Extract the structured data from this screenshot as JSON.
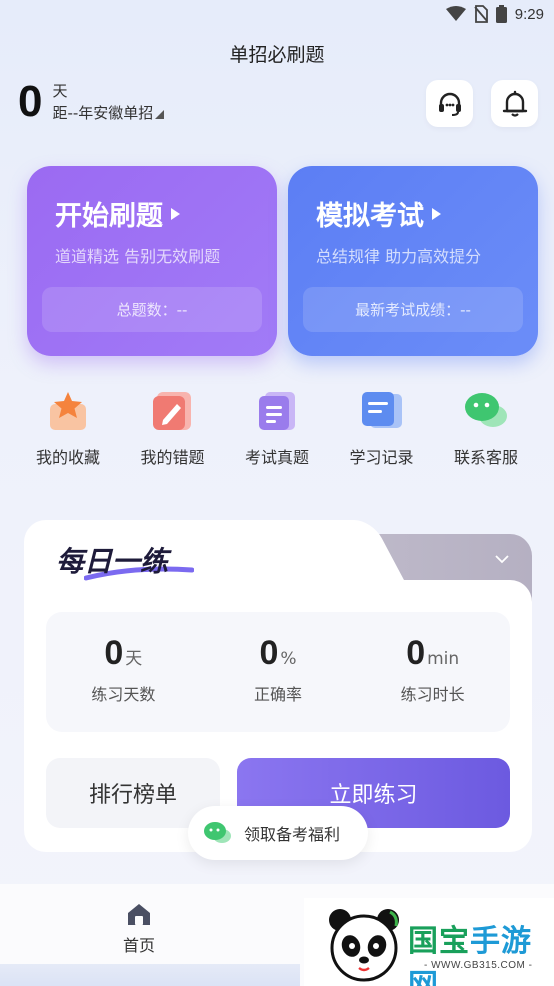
{
  "status_bar": {
    "time": "9:29"
  },
  "header": {
    "title": "单招必刷题",
    "countdown_number": "0",
    "countdown_unit": "天",
    "countdown_desc": "距--年安徽单招"
  },
  "cards": [
    {
      "title": "开始刷题",
      "subtitle": "道道精选 告别无效刷题",
      "footer": "总题数：--",
      "color": "#9b6af2"
    },
    {
      "title": "模拟考试",
      "subtitle": "总结规律 助力高效提分",
      "footer": "最新考试成绩：--",
      "color": "#5c7ef4"
    }
  ],
  "quick_links": [
    {
      "label": "我的收藏",
      "icon": "star-folder-icon"
    },
    {
      "label": "我的错题",
      "icon": "pen-book-icon"
    },
    {
      "label": "考试真题",
      "icon": "exam-paper-icon"
    },
    {
      "label": "学习记录",
      "icon": "study-record-icon"
    },
    {
      "label": "联系客服",
      "icon": "wechat-service-icon"
    }
  ],
  "daily": {
    "title": "每日一练",
    "stats": [
      {
        "value": "0",
        "unit": "天",
        "label": "练习天数"
      },
      {
        "value": "0",
        "unit": "%",
        "label": "正确率"
      },
      {
        "value": "0",
        "unit": "min",
        "label": "练习时长"
      }
    ],
    "rank_label": "排行榜单",
    "practice_label": "立即练习"
  },
  "welfare": {
    "label": "领取备考福利"
  },
  "tabbar": {
    "home_label": "首页"
  },
  "watermark": {
    "title_part1": "国宝",
    "title_part2": "手游网",
    "url": "- WWW.GB315.COM -"
  },
  "colors": {
    "accent_purple": "#9b6af2",
    "accent_blue": "#5c7ef4",
    "practice_button": "#7866e8"
  }
}
